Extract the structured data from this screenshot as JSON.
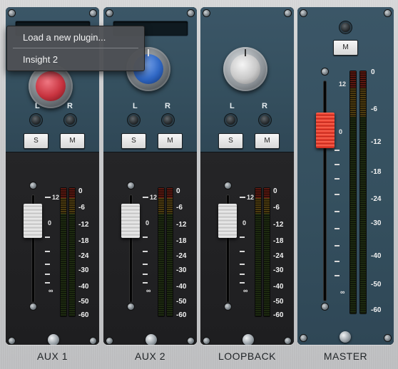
{
  "colors": {
    "panel_blue": "#35505f",
    "fader_bg": "#1e1e20",
    "knob_red": "#c83440",
    "knob_blue": "#2f67c4",
    "knob_grey": "#c8c8c8",
    "master_fader": "#e23a2a",
    "menu_bg": "#4e5054"
  },
  "context_menu": {
    "items": [
      "Load a new plugin...",
      "Insight 2"
    ]
  },
  "channels": [
    {
      "name": "AUX 1",
      "knob_color": "red",
      "pan_left": "L",
      "pan_right": "R",
      "solo": "S",
      "mute": "M"
    },
    {
      "name": "AUX 2",
      "knob_color": "blue",
      "pan_left": "L",
      "pan_right": "R",
      "solo": "S",
      "mute": "M"
    },
    {
      "name": "LOOPBACK",
      "knob_color": "grey",
      "pan_left": "L",
      "pan_right": "R",
      "solo": "S",
      "mute": "M"
    }
  ],
  "master": {
    "name": "MASTER",
    "mute": "M"
  },
  "fader_scale": [
    "12",
    "0",
    "∞"
  ],
  "meter_scale": [
    "0",
    "-6",
    "-12",
    "-18",
    "-24",
    "-30",
    "-40",
    "-50",
    "-60"
  ]
}
